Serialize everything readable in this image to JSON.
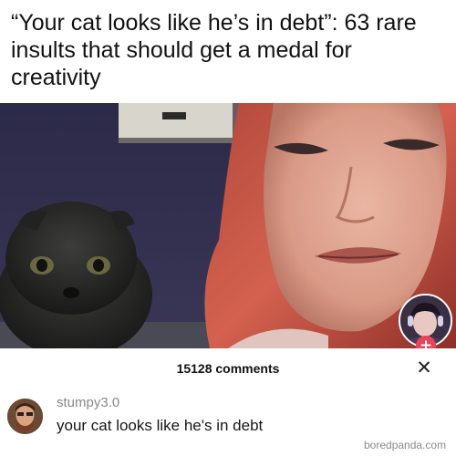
{
  "article": {
    "headline": "“Your cat looks like he’s in debt”: 63 rare insults that should get a medal for creativity"
  },
  "video": {
    "subject": "woman-and-cat-video-frame"
  },
  "creator_avatar": {
    "icon": "profile-avatar-icon",
    "follow_symbol": "+",
    "follow_color": "#ea4359"
  },
  "comments": {
    "count_label": "15128 comments",
    "close_symbol": "✕",
    "items": [
      {
        "username": "stumpy3.0",
        "text": "your cat looks like he's in debt"
      }
    ]
  },
  "watermark": "boredpanda.com",
  "colors": {
    "accent": "#ea4359",
    "username": "#888888",
    "text": "#161616"
  }
}
